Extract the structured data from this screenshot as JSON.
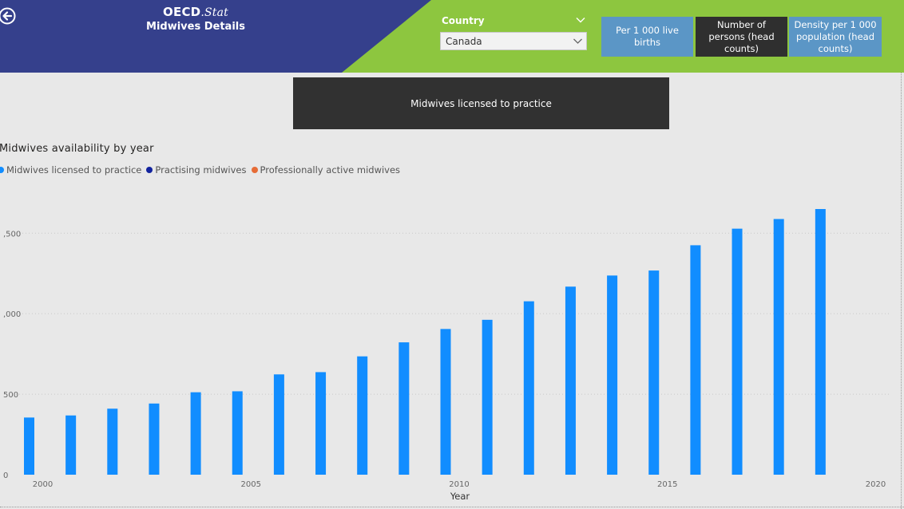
{
  "header": {
    "brand": "OECD",
    "brand_suffix": ".Stat",
    "subtitle": "Midwives Details",
    "colors": {
      "navy": "#35408c",
      "green": "#8dc63f",
      "back_icon": "back-arrow-circle-icon"
    }
  },
  "filters": {
    "country_label": "Country",
    "country_value": "Canada"
  },
  "toggles": [
    {
      "label": "Per 1 000 live births",
      "selected": false
    },
    {
      "label": "Number of persons (head counts)",
      "selected": true
    },
    {
      "label": "Density per 1 000 population (head counts)",
      "selected": false
    }
  ],
  "metric_card": {
    "label": "Midwives licensed to practice"
  },
  "chart": {
    "title": "Midwives availability by year",
    "legend": [
      {
        "name": "Midwives licensed to practice",
        "color": "#118dff"
      },
      {
        "name": "Practising midwives",
        "color": "#12239e"
      },
      {
        "name": "Professionally active midwives",
        "color": "#e66c37"
      }
    ]
  },
  "chart_data": {
    "type": "bar",
    "xlabel": "Year",
    "ylabel": "",
    "ylim": [
      0,
      1650
    ],
    "xlim": [
      1999.5,
      2020
    ],
    "x_ticks": [
      2000,
      2005,
      2010,
      2015,
      2020
    ],
    "y_ticks": [
      0,
      500,
      1000,
      1500
    ],
    "y_tick_labels": [
      "0",
      "500",
      ",000",
      ",500"
    ],
    "grid": true,
    "legend_position": "top-left",
    "series": [
      {
        "name": "Midwives licensed to practice",
        "color": "#118dff",
        "x": [
          2000,
          2001,
          2002,
          2003,
          2004,
          2005,
          2006,
          2007,
          2008,
          2009,
          2010,
          2011,
          2012,
          2013,
          2014,
          2015,
          2016,
          2017,
          2018,
          2019
        ],
        "values": [
          355,
          368,
          410,
          442,
          512,
          518,
          623,
          637,
          735,
          822,
          905,
          962,
          1077,
          1168,
          1237,
          1268,
          1425,
          1528,
          1588,
          1650
        ]
      }
    ]
  }
}
